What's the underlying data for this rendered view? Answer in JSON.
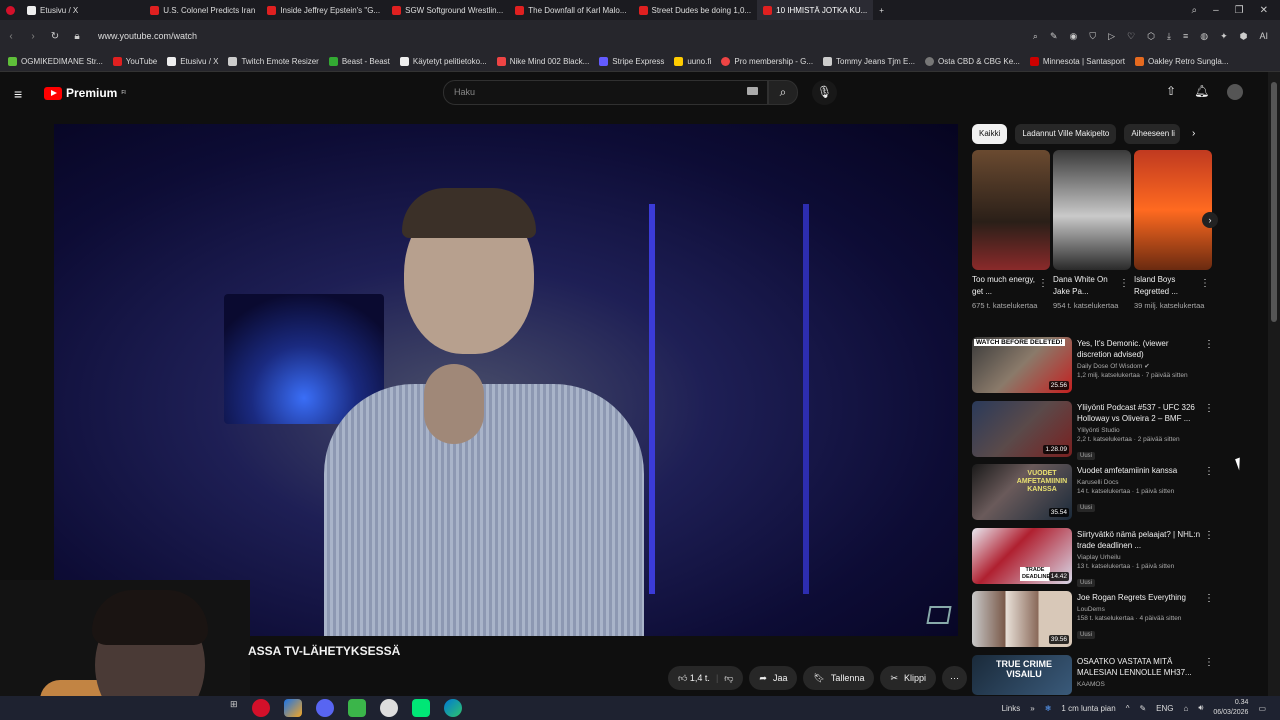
{
  "browser": {
    "tabs": [
      {
        "label": "Etusivu / X",
        "active": false
      },
      {
        "label": "U.S. Colonel Predicts Iran",
        "active": false
      },
      {
        "label": "Inside Jeffrey Epstein's \"G...",
        "active": false
      },
      {
        "label": "SGW Softground Wrestlin...",
        "active": false
      },
      {
        "label": "The Downfall of Karl Malo...",
        "active": false
      },
      {
        "label": "Street Dudes be doing 1,0...",
        "active": false
      },
      {
        "label": "10 IHMISTÄ JOTKA KU...",
        "active": true
      }
    ],
    "url": "www.youtube.com/watch",
    "bookmarks": [
      "OGMIKEDIMANE Str...",
      "YouTube",
      "Etusivu / X",
      "Twitch Emote Resizer",
      "Beast - Beast",
      "Käytetyt pelitietoko...",
      "Nike Mind 002 Black...",
      "Stripe Express",
      "uuno.fi",
      "Pro membership - G...",
      "Tommy Jeans Tjm E...",
      "Osta CBD & CBG Ke...",
      "Minnesota | Santasport",
      "Oakley Retro Sungla..."
    ]
  },
  "youtube": {
    "logo": "Premium",
    "logo_sup": "FI",
    "search_placeholder": "Haku",
    "video_title": "ASSA TV-LÄHETYKSESSÄ",
    "actions": {
      "likes": "1,4 t.",
      "share": "Jaa",
      "save": "Tallenna",
      "clip": "Klippi"
    },
    "chips": [
      "Kaikki",
      "Ladannut Ville Makipelto",
      "Aiheeseen li"
    ],
    "shorts": [
      {
        "title": "Too much energy, get ...",
        "views": "675 t. katselukertaa"
      },
      {
        "title": "Dana White On Jake Pa...",
        "views": "954 t. katselukertaa"
      },
      {
        "title": "Island Boys Regretted ...",
        "views": "39 milj. katselukertaa"
      }
    ],
    "videos": [
      {
        "title": "Yes, It's Demonic. (viewer discretion advised)",
        "channel": "Daily Dose Of Wisdom",
        "meta": "1,2 milj. katselukertaa · 7 päivää sitten",
        "duration": "25.56",
        "new": "",
        "thumb_text": "WATCH BEFORE DELETED!"
      },
      {
        "title": "Yliiyönti Podcast #537 - UFC 326 Holloway vs Oliveira 2 – BMF ...",
        "channel": "Ylilyönti Studio",
        "meta": "2,2 t. katselukertaa · 2 päivää sitten",
        "duration": "1.28.09",
        "new": "Uusi",
        "thumb_text": ""
      },
      {
        "title": "Vuodet amfetamiinin kanssa",
        "channel": "Karuselli Docs",
        "meta": "14 t. katselukertaa · 1 päivä sitten",
        "duration": "35.54",
        "new": "Uusi",
        "thumb_text": "VUODET AMFETAMIININ KANSSA"
      },
      {
        "title": "Siirtyvätkö nämä pelaajat? | NHL:n trade deadlinen ...",
        "channel": "Viaplay Urheilu",
        "meta": "13 t. katselukertaa · 1 päivä sitten",
        "duration": "14.42",
        "new": "Uusi",
        "thumb_text": "TRADE DEADLINE"
      },
      {
        "title": "Joe Rogan Regrets Everything",
        "channel": "LouDems",
        "meta": "158 t. katselukertaa · 4 päivää sitten",
        "duration": "39.56",
        "new": "Uusi",
        "thumb_text": ""
      },
      {
        "title": "OSAATKO VASTATA MITÄ MALESIAN LENNOLLE MH37...",
        "channel": "KAAMOS",
        "meta": "",
        "duration": "",
        "new": "",
        "thumb_text": "TRUE CRIME VISAILU"
      }
    ]
  },
  "taskbar": {
    "links": "Links",
    "weather": "1 cm lunta pian",
    "lang": "ENG",
    "time": "0.34",
    "date": "06/03/2026"
  },
  "colors": {
    "bg": "#0f0f0f",
    "accent": "#ff0000",
    "chip_active": "#f1f1f1"
  }
}
